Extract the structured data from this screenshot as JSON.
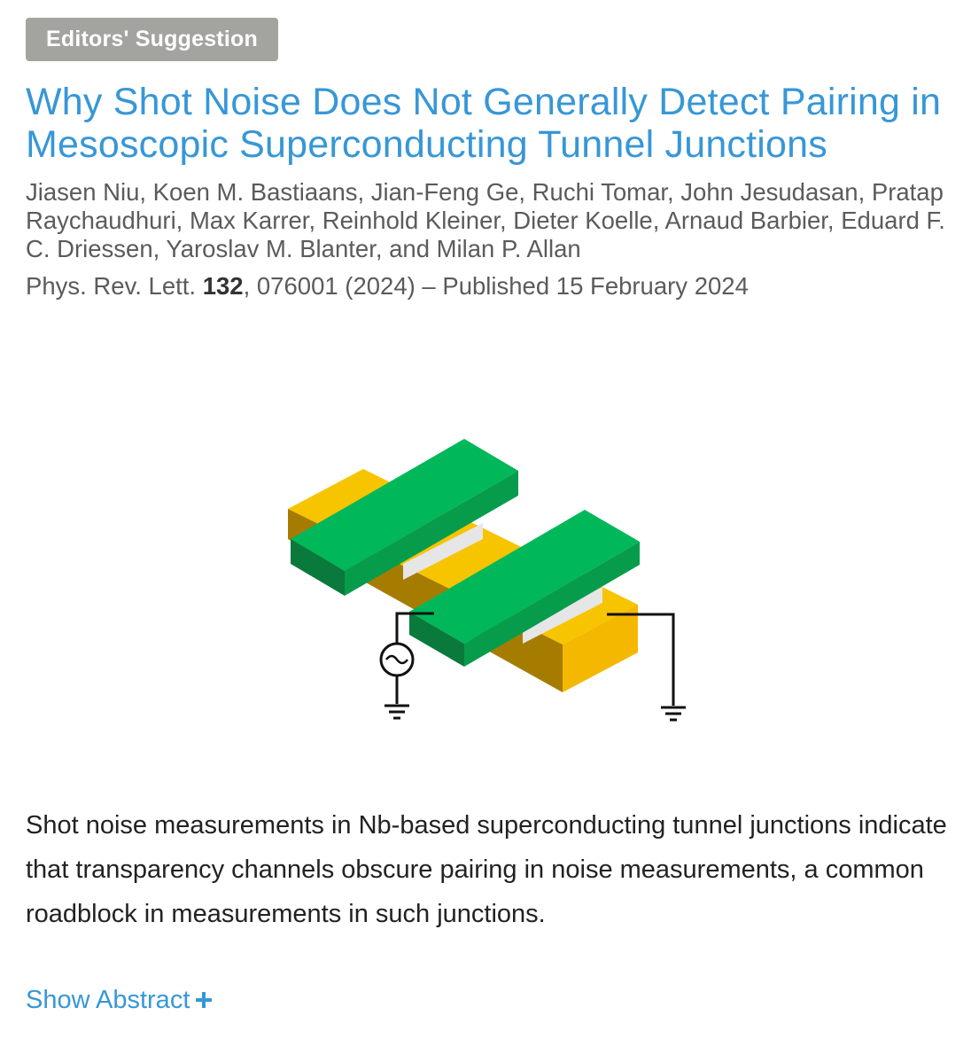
{
  "badge": "Editors' Suggestion",
  "title": "Why Shot Noise Does Not Generally Detect Pairing in Mesoscopic Superconducting Tunnel Junctions",
  "authors": "Jiasen Niu, Koen M. Bastiaans, Jian-Feng Ge, Ruchi Tomar, John Jesudasan, Pratap Raychaudhuri, Max Karrer, Reinhold Kleiner, Dieter Koelle, Arnaud Barbier, Eduard F. C. Driessen, Yaroslav M. Blanter, and Milan P. Allan",
  "citation": {
    "journal": "Phys. Rev. Lett.",
    "volume": "132",
    "rest": ", 076001 (2024) – Published 15 February 2024"
  },
  "figure": {
    "colors": {
      "electrode_top": "#00b85a",
      "electrode_front": "#0a7a3c",
      "electrode_side": "#069c4c",
      "bottom_top": "#f7c400",
      "bottom_front": "#a67c00",
      "barrier": "#e6e6e6",
      "wire": "#111111"
    },
    "icons": [
      "ac-source-icon",
      "ground-icon"
    ]
  },
  "summary": "Shot noise measurements in Nb-based superconducting tunnel junctions indicate that transparency channels obscure pairing in noise measurements, a common roadblock in measurements in such junctions.",
  "show_abstract": {
    "label": "Show Abstract",
    "icon": "plus-icon"
  },
  "colors": {
    "link": "#3797d6",
    "badge_bg": "#a3a3a0"
  }
}
